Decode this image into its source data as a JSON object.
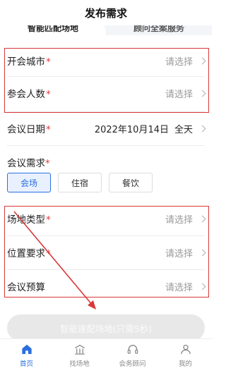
{
  "header": {
    "title": "发布需求"
  },
  "tabs": [
    {
      "label": "智能匹配场地"
    },
    {
      "label": "顾问全案服务"
    }
  ],
  "form": {
    "city": {
      "label": "开会城市",
      "required": "*",
      "placeholder": "请选择"
    },
    "attendees": {
      "label": "参会人数",
      "required": "*",
      "placeholder": "请选择"
    },
    "date": {
      "label": "会议日期",
      "required": "*",
      "value": "2022年10月14日",
      "duration": "全天"
    },
    "needs": {
      "label": "会议需求",
      "required": "*",
      "options": [
        {
          "label": "会场",
          "selected": true
        },
        {
          "label": "住宿",
          "selected": false
        },
        {
          "label": "餐饮",
          "selected": false
        }
      ]
    },
    "venue_type": {
      "label": "场地类型",
      "required": "*",
      "placeholder": "请选择"
    },
    "location": {
      "label": "位置要求",
      "required": "*",
      "placeholder": "请选择"
    },
    "budget": {
      "label": "会议预算",
      "placeholder": "请选择"
    }
  },
  "cta": {
    "label": "智能速配场地(只需5秒)"
  },
  "tabbar": [
    {
      "label": "首页",
      "icon": "home-icon",
      "active": true
    },
    {
      "label": "找场地",
      "icon": "venue-icon",
      "active": false
    },
    {
      "label": "会务顾问",
      "icon": "headset-icon",
      "active": false
    },
    {
      "label": "我的",
      "icon": "user-icon",
      "active": false
    }
  ],
  "colors": {
    "accent": "#2a6fe0",
    "required": "#e23b3b",
    "annotation": "#d83838",
    "placeholder": "#9a9a9a"
  }
}
